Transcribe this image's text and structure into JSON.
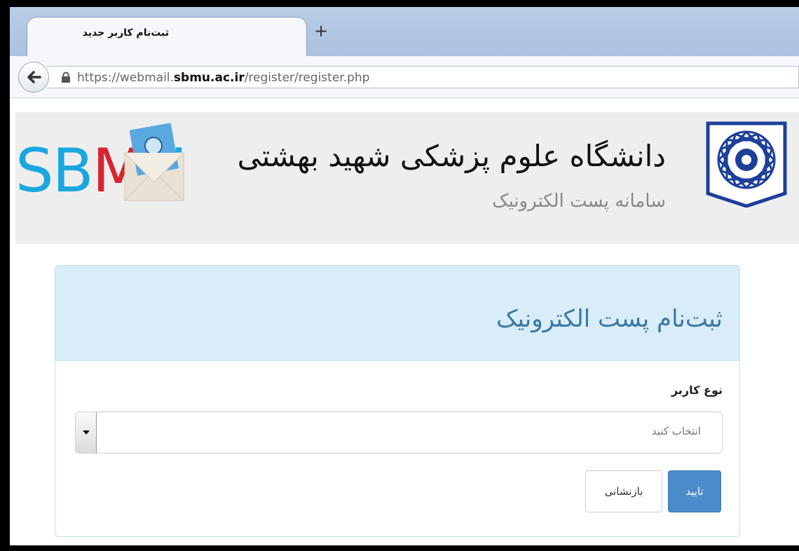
{
  "browser": {
    "tab_title": "ثبت‌نام کاربر جدید",
    "new_tab_symbol": "+",
    "url_prefix": "https://webmail.",
    "url_domain": "sbmu.ac.ir",
    "url_path": "/register/register.php"
  },
  "header": {
    "logo_text_left": "SB",
    "logo_text_m": "M",
    "logo_text_right": "U",
    "university_name": "دانشگاه علوم پزشکی شهید بهشتی",
    "system_name": "سامانه پست الکترونیک"
  },
  "panel": {
    "title": "ثبت‌نام پست الکترونیک",
    "user_type_label": "نوع کاربر",
    "user_type_select_value": "انتخاب کنید",
    "confirm_button": "تایید",
    "reset_button": "بازنشانی"
  },
  "colors": {
    "accent": "#4a8bc9",
    "panel_heading_bg": "#d8edf7",
    "logo_blue": "#1aa7df",
    "logo_red": "#d9232e",
    "emblem_blue": "#1d3f9a"
  }
}
